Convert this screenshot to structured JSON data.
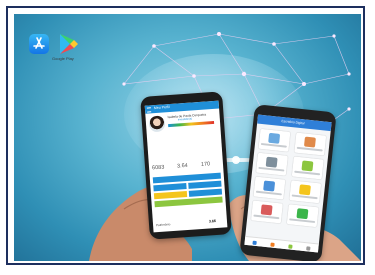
{
  "badges": {
    "google_play_text": "Google Play"
  },
  "left_phone": {
    "header_title": "Meu Perfil",
    "user_name": "Isabela de Paula Cerqueira",
    "user_sub": "Investidor(a)",
    "stats": [
      "6083",
      "3.64",
      "170"
    ],
    "bottom_label": "Patrimônio",
    "bottom_value": "3.66"
  },
  "right_phone": {
    "header_title": "Escritório Digital"
  },
  "colors": {
    "frame": "#1d2f5e",
    "brand_blue": "#1f8fd8",
    "accent_yellow": "#f4c51d",
    "accent_green": "#8cc63f"
  }
}
